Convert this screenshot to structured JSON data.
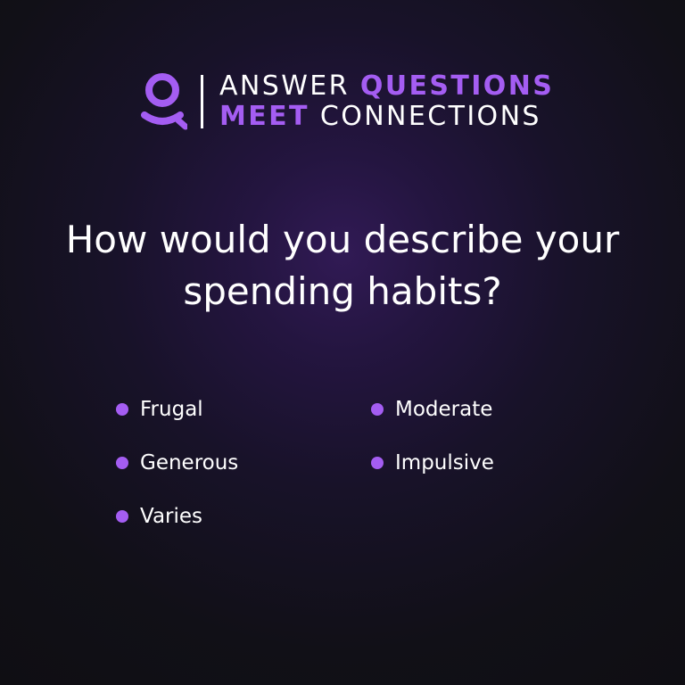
{
  "brand": {
    "icon": "user-icon",
    "line1_regular": "ANSWER",
    "line1_bold": "QUESTIONS",
    "line2_bold": "MEET",
    "line2_regular": "CONNECTIONS"
  },
  "question": {
    "line1": "How would you describe your",
    "line2": "spending habits?"
  },
  "options": [
    {
      "label": "Frugal"
    },
    {
      "label": "Moderate"
    },
    {
      "label": "Generous"
    },
    {
      "label": "Impulsive"
    },
    {
      "label": "Varies"
    }
  ],
  "colors": {
    "accent": "#a45df2",
    "text": "#ffffff",
    "background": "#111017",
    "glow": "#311a55"
  }
}
